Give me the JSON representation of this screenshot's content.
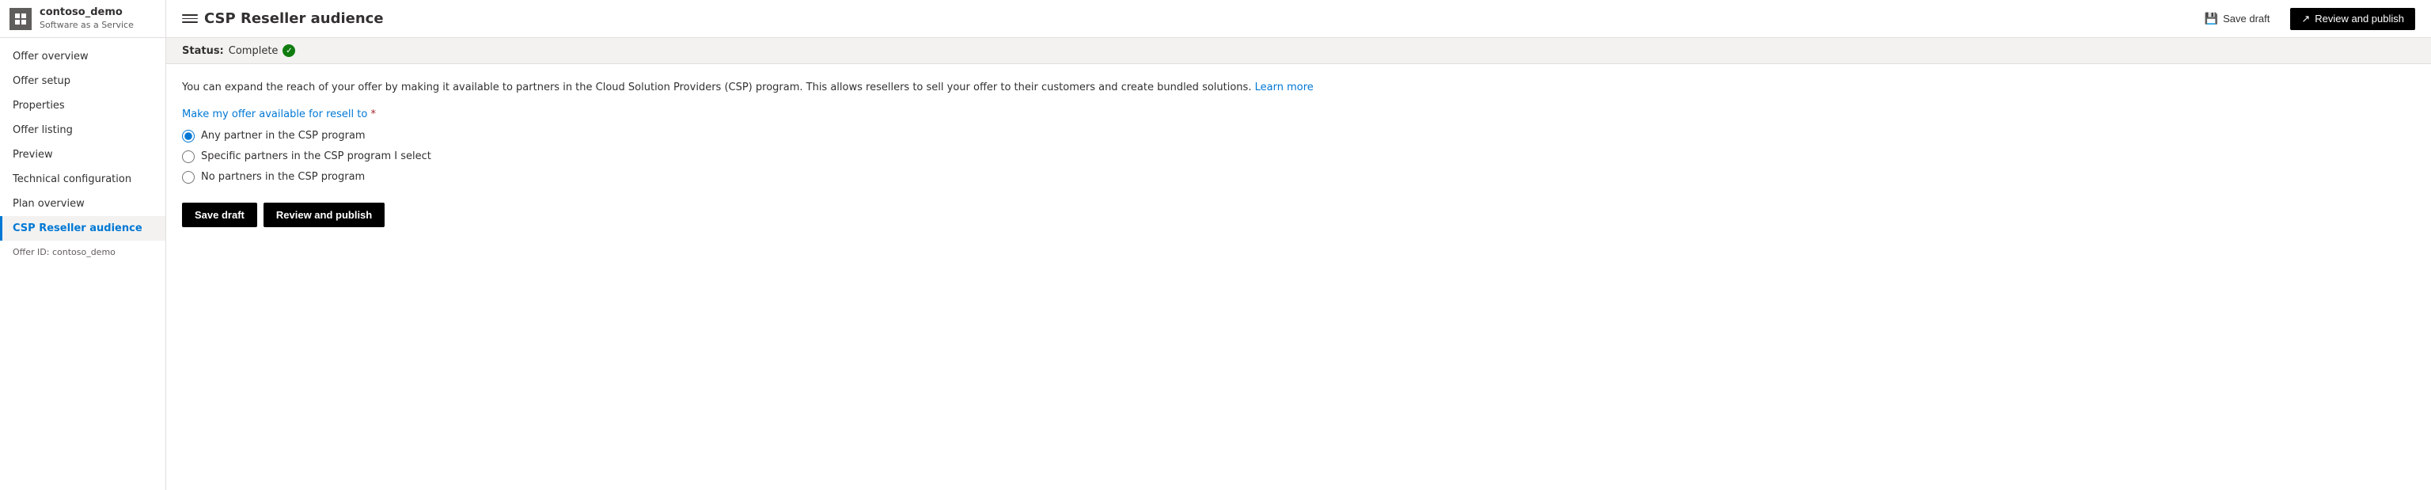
{
  "app": {
    "icon_label": "grid-icon",
    "title": "contoso_demo",
    "subtitle": "Software as a Service"
  },
  "header": {
    "page_title": "CSP Reseller audience",
    "hamburger_label": "toggle-nav",
    "save_draft_label": "Save draft",
    "review_publish_label": "Review and publish"
  },
  "status": {
    "label": "Status:",
    "value": "Complete",
    "icon": "✓"
  },
  "sidebar": {
    "items": [
      {
        "id": "offer-overview",
        "label": "Offer overview",
        "active": false
      },
      {
        "id": "offer-setup",
        "label": "Offer setup",
        "active": false
      },
      {
        "id": "properties",
        "label": "Properties",
        "active": false
      },
      {
        "id": "offer-listing",
        "label": "Offer listing",
        "active": false
      },
      {
        "id": "preview",
        "label": "Preview",
        "active": false
      },
      {
        "id": "technical-configuration",
        "label": "Technical configuration",
        "active": false
      },
      {
        "id": "plan-overview",
        "label": "Plan overview",
        "active": false
      },
      {
        "id": "csp-reseller-audience",
        "label": "CSP Reseller audience",
        "active": true
      }
    ],
    "offer_id_label": "Offer ID: contoso_demo"
  },
  "content": {
    "description": "You can expand the reach of your offer by making it available to partners in the Cloud Solution Providers (CSP) program. This allows resellers to sell your offer to their customers and create bundled solutions.",
    "learn_more_label": "Learn more",
    "resell_label": "Make my offer available for resell to",
    "required_indicator": "*",
    "radio_options": [
      {
        "id": "any-partner",
        "label": "Any partner in the CSP program",
        "checked": true
      },
      {
        "id": "specific-partners",
        "label": "Specific partners in the CSP program I select",
        "checked": false
      },
      {
        "id": "no-partners",
        "label": "No partners in the CSP program",
        "checked": false
      }
    ],
    "save_draft_label": "Save draft",
    "review_publish_label": "Review and publish"
  }
}
